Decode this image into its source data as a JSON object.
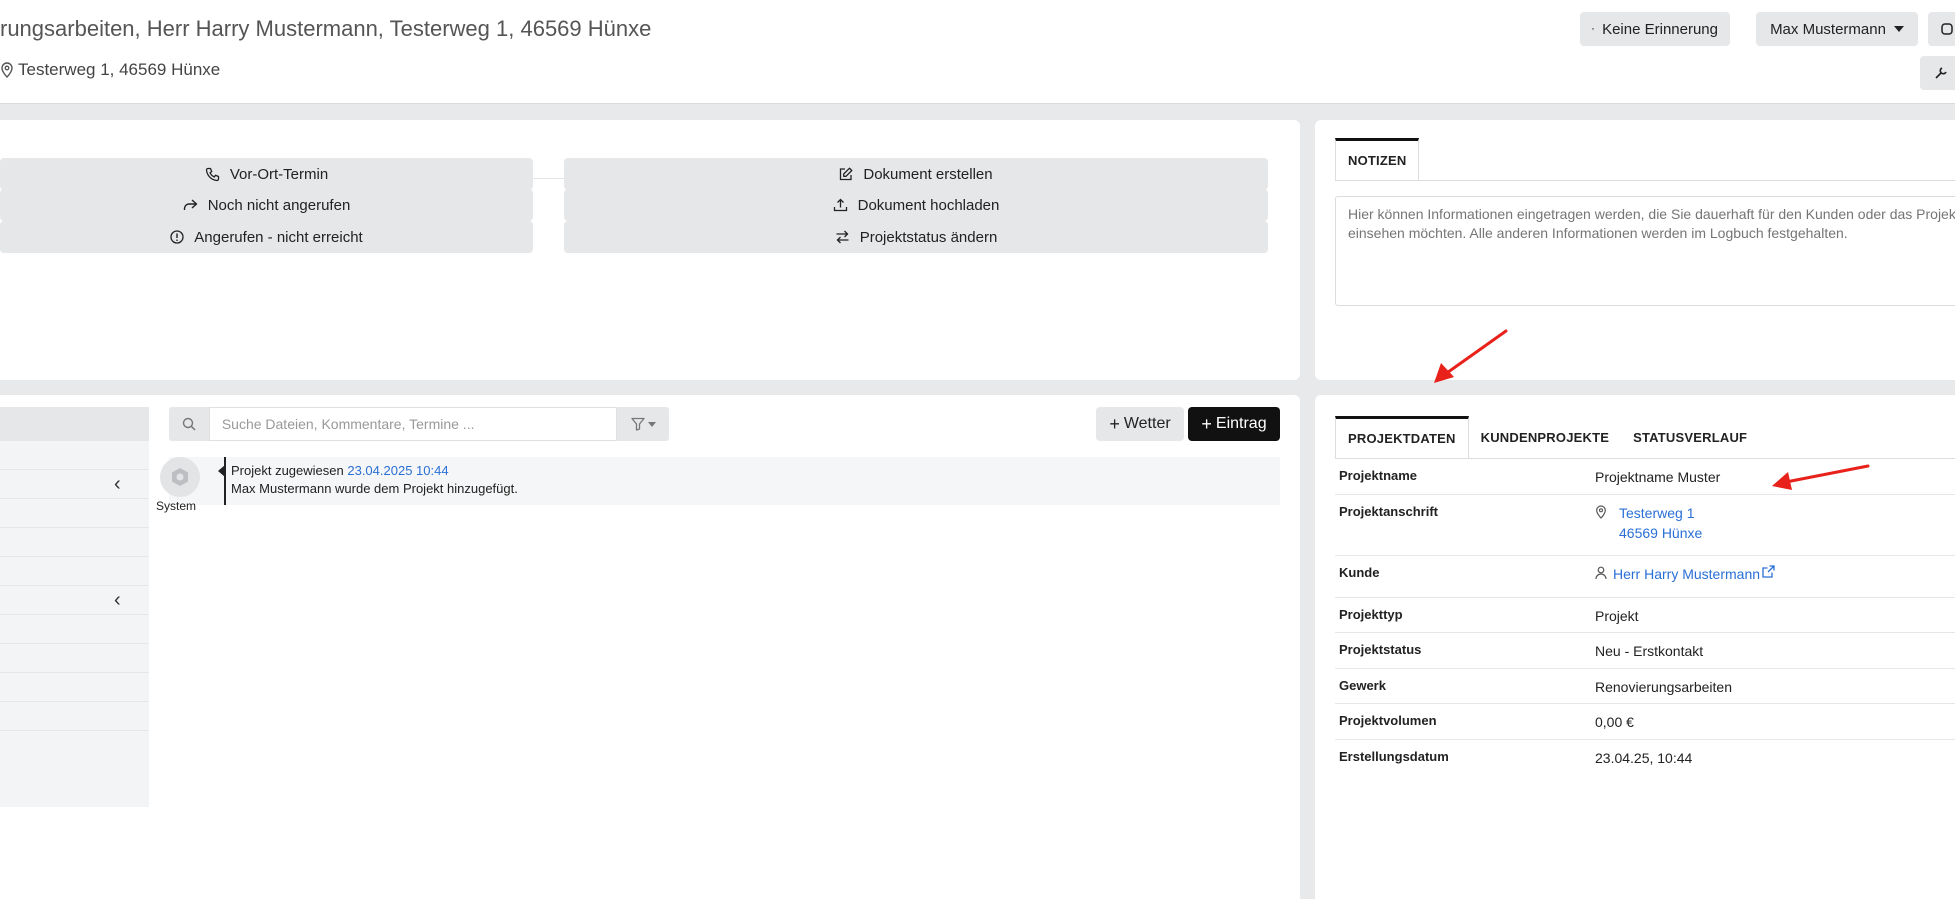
{
  "header": {
    "title": "rungsarbeiten, Herr Harry Mustermann, Testerweg 1, 46569 Hünxe",
    "address": "Testerweg 1, 46569 Hünxe",
    "reminder_label": "Keine Erinnerung",
    "user_label": "Max Mustermann"
  },
  "actions": {
    "left": [
      {
        "label": "Vor-Ort-Termin",
        "icon": "phone-icon"
      },
      {
        "label": "Noch nicht angerufen",
        "icon": "share-icon"
      },
      {
        "label": "Angerufen - nicht erreicht",
        "icon": "alert-circle-icon"
      }
    ],
    "right": [
      {
        "label": "Dokument erstellen",
        "icon": "edit-icon"
      },
      {
        "label": "Dokument hochladen",
        "icon": "upload-icon"
      },
      {
        "label": "Projektstatus ändern",
        "icon": "swap-icon"
      }
    ]
  },
  "notes": {
    "tab_label": "NOTIZEN",
    "placeholder": "Hier können Informationen eingetragen werden, die Sie dauerhaft für den Kunden oder das Projekt einsehen möchten. Alle anderen Informationen werden im Logbuch festgehalten."
  },
  "log": {
    "search_placeholder": "Suche Dateien, Kommentare, Termine ...",
    "wetter_label": "Wetter",
    "eintrag_label": "Eintrag",
    "entries": [
      {
        "author": "System",
        "prefix": "Projekt zugewiesen",
        "timestamp": "23.04.2025 10:44",
        "text": "Max Mustermann wurde dem Projekt hinzugefügt."
      }
    ]
  },
  "project": {
    "tabs": [
      "PROJEKTDATEN",
      "KUNDENPROJEKTE",
      "STATUSVERLAUF"
    ],
    "rows": {
      "name": {
        "label": "Projektname",
        "value": "Projektname Muster"
      },
      "address": {
        "label": "Projektanschrift",
        "line1": "Testerweg 1",
        "line2": "46569 Hünxe"
      },
      "customer": {
        "label": "Kunde",
        "value": "Herr Harry Mustermann"
      },
      "type": {
        "label": "Projekttyp",
        "value": "Projekt"
      },
      "status": {
        "label": "Projektstatus",
        "value": "Neu - Erstkontakt"
      },
      "trade": {
        "label": "Gewerk",
        "value": "Renovierungsarbeiten"
      },
      "volume": {
        "label": "Projektvolumen",
        "value": "0,00 €"
      },
      "created": {
        "label": "Erstellungsdatum",
        "value": "23.04.25, 10:44"
      }
    }
  },
  "colors": {
    "link": "#2a6fd6",
    "annotation_arrow": "#e8221b",
    "primary_button": "#111111"
  }
}
